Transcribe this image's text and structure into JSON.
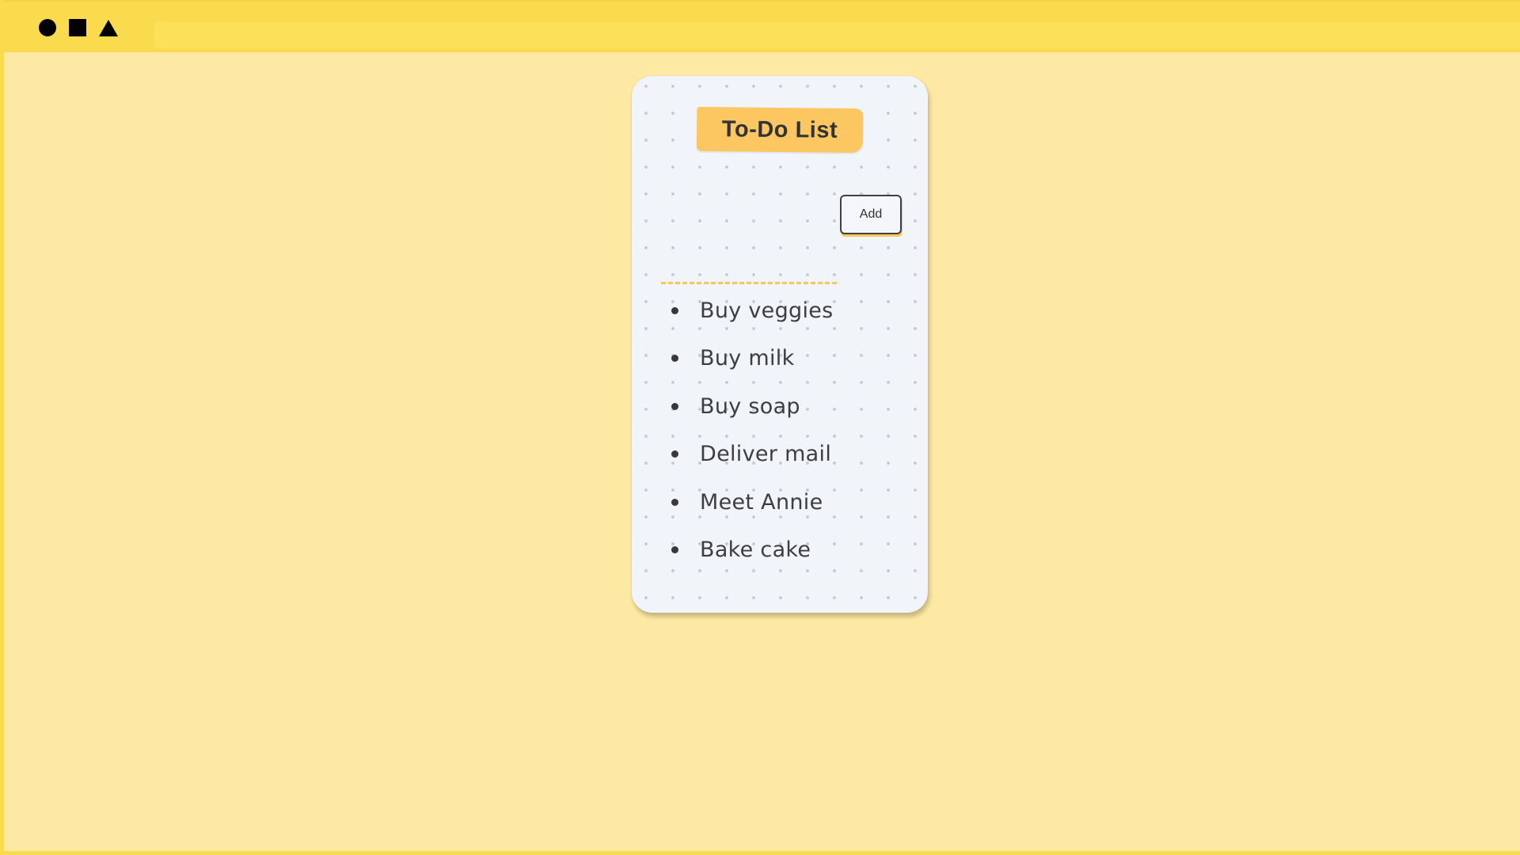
{
  "window": {
    "controls": [
      "circle-shape",
      "square-shape",
      "triangle-shape"
    ]
  },
  "todo": {
    "title": "To-Do List",
    "input": {
      "value": "",
      "placeholder": ""
    },
    "add_label": "Add",
    "items": [
      "Buy veggies",
      "Buy milk",
      "Buy soap",
      "Deliver mail",
      "Meet Annie",
      "Bake cake"
    ]
  },
  "colors": {
    "background": "#fde9a3",
    "topbar": "#fbdb4e",
    "card": "#f1f4f9",
    "title_tag": "#fcc760",
    "input_underline": "#f7c659",
    "text": "#3d3d42"
  }
}
